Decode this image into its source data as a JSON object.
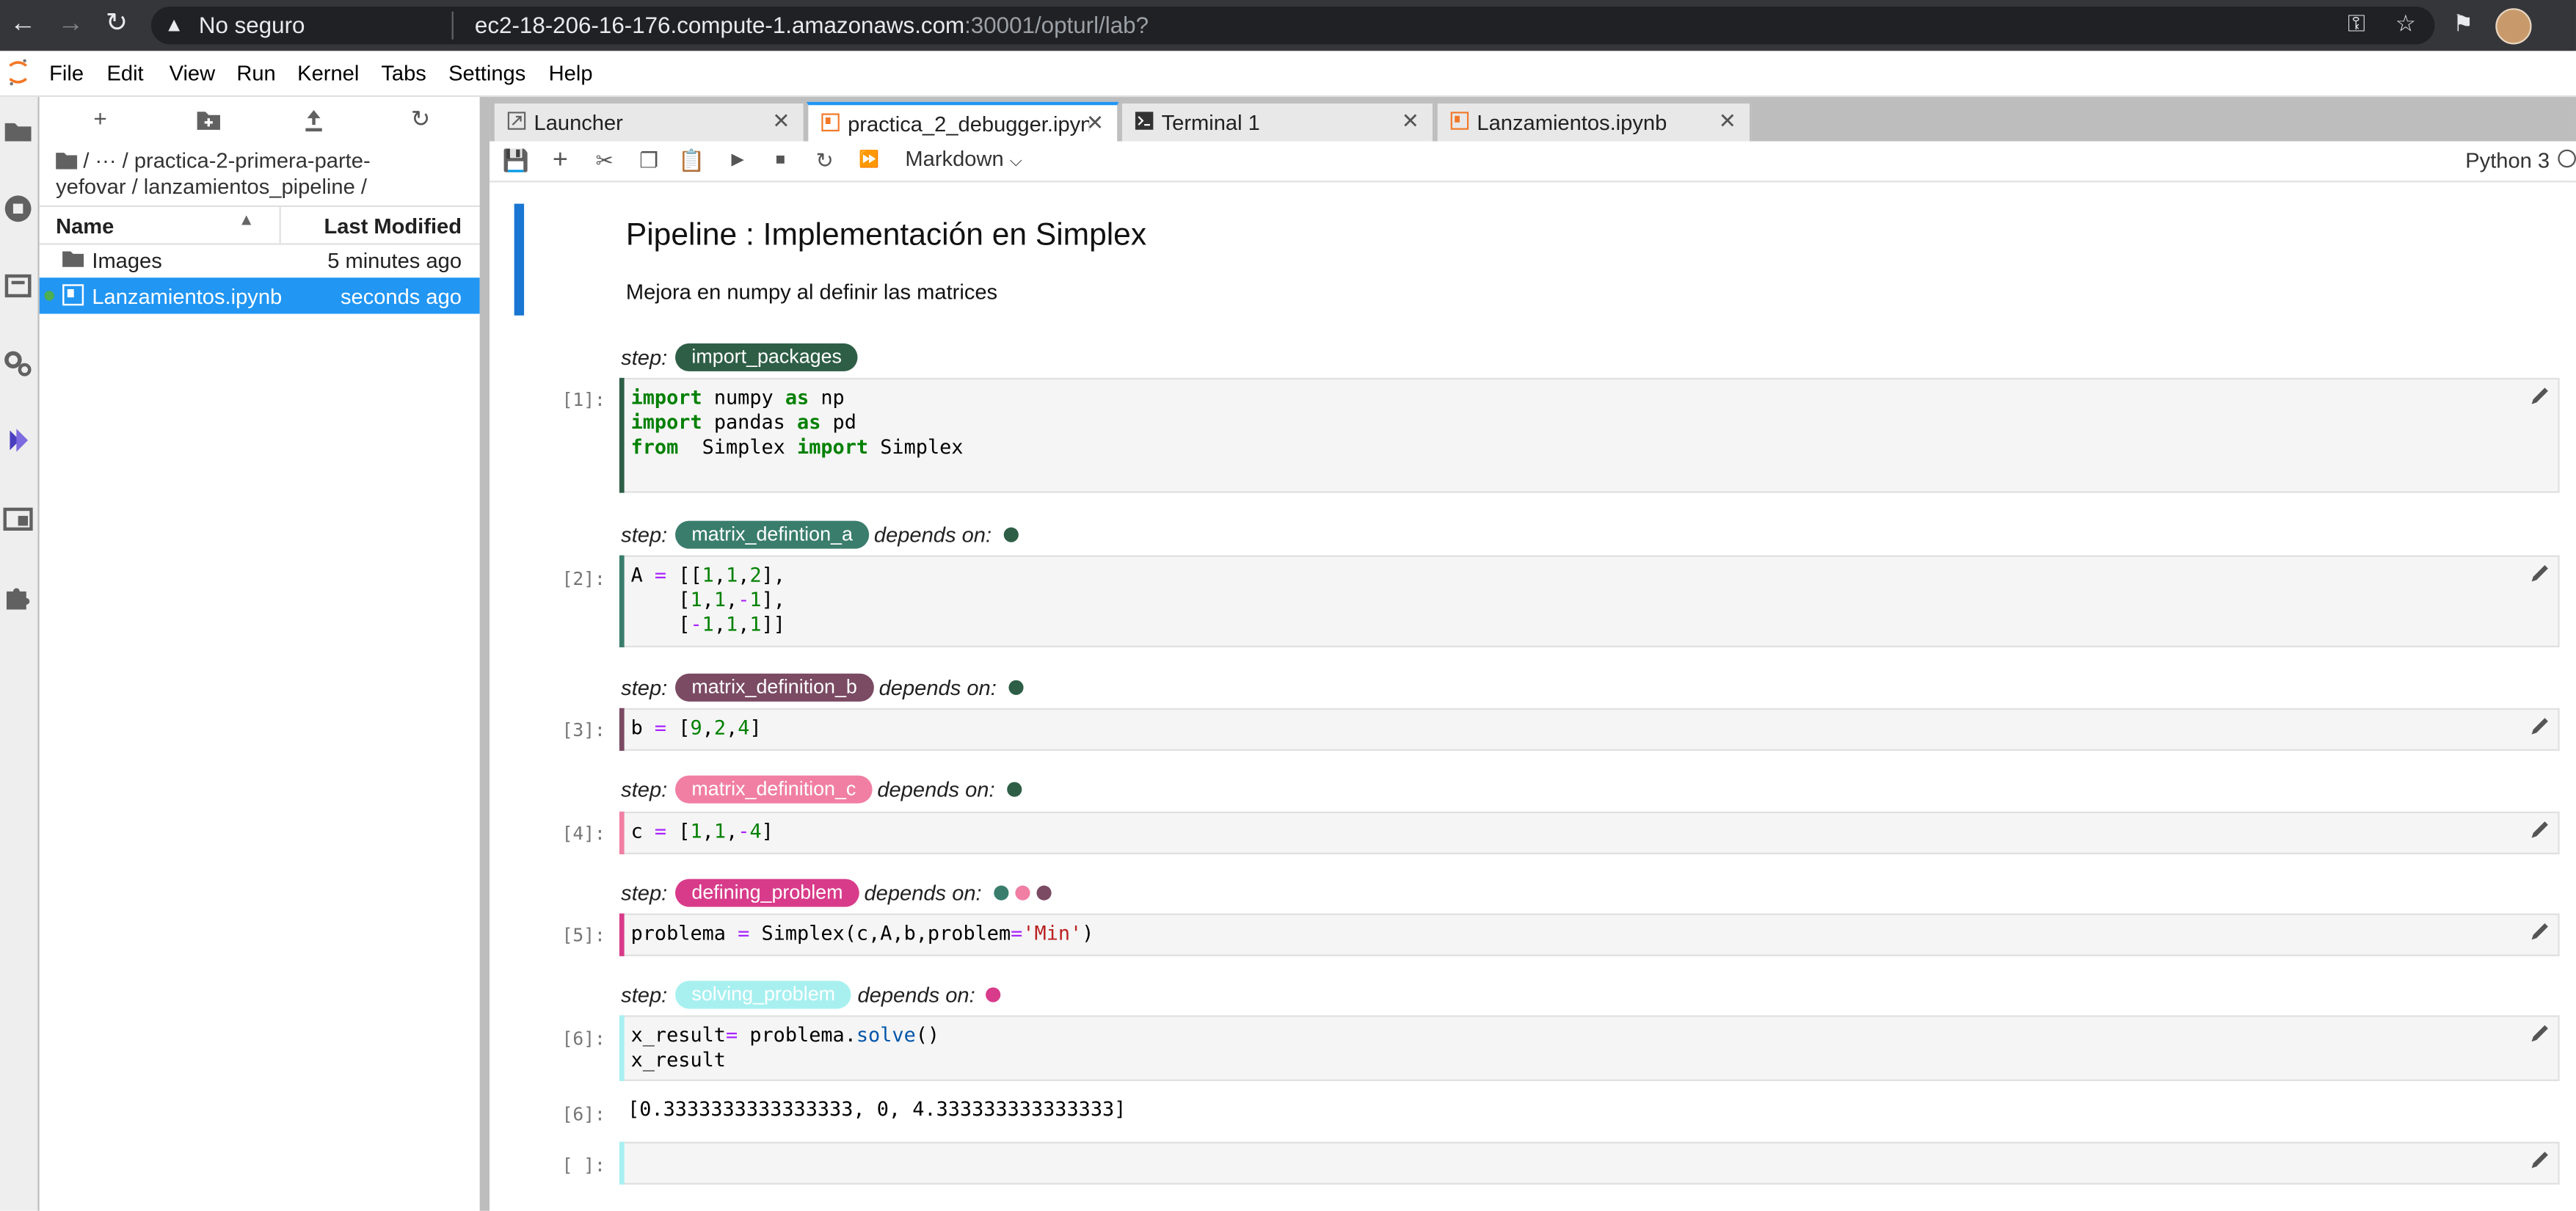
{
  "browser": {
    "security_text": "No seguro",
    "url_host": "ec2-18-206-16-176.compute-1.amazonaws.com",
    "url_rest": ":30001/opturl/lab?"
  },
  "menu": [
    "File",
    "Edit",
    "View",
    "Run",
    "Kernel",
    "Tabs",
    "Settings",
    "Help"
  ],
  "file_browser": {
    "breadcrumb_line1": "/   ···  / practica-2-primera-parte-",
    "breadcrumb_line2": "yefovar / lanzamientos_pipeline /",
    "col_name": "Name",
    "col_modified": "Last Modified",
    "items": [
      {
        "name": "Images",
        "modified": "5 minutes ago"
      },
      {
        "name": "Lanzamientos.ipynb",
        "modified": "seconds ago"
      }
    ]
  },
  "tabs": [
    {
      "label": "Launcher"
    },
    {
      "label": "practica_2_debugger.ipynb"
    },
    {
      "label": "Terminal 1"
    },
    {
      "label": "Lanzamientos.ipynb"
    }
  ],
  "toolbar": {
    "cell_type": "Markdown",
    "kernel": "Python 3"
  },
  "notebook": {
    "title": "Pipeline : Implementación en Simplex",
    "subtitle": "Mejora en numpy al definir las matrices",
    "step_label": "step:",
    "depends_label": "depends on:",
    "steps": [
      {
        "name": "import_packages",
        "color": "#2e5e46",
        "prompt": "[1]:"
      },
      {
        "name": "matrix_defintion_a",
        "color": "#3a7d6c",
        "prompt": "[2]:"
      },
      {
        "name": "matrix_definition_b",
        "color": "#7b4a63",
        "prompt": "[3]:"
      },
      {
        "name": "matrix_definition_c",
        "color": "#f17fa4",
        "prompt": "[4]:"
      },
      {
        "name": "defining_problem",
        "color": "#d83b8a",
        "prompt": "[5]:"
      },
      {
        "name": "solving_problem",
        "color": "#a8f0f0",
        "prompt": "[6]:"
      }
    ],
    "output_prompt": "[6]:",
    "output": "[0.3333333333333333, 0, 4.333333333333333]",
    "empty_prompt": "[ ]:"
  }
}
